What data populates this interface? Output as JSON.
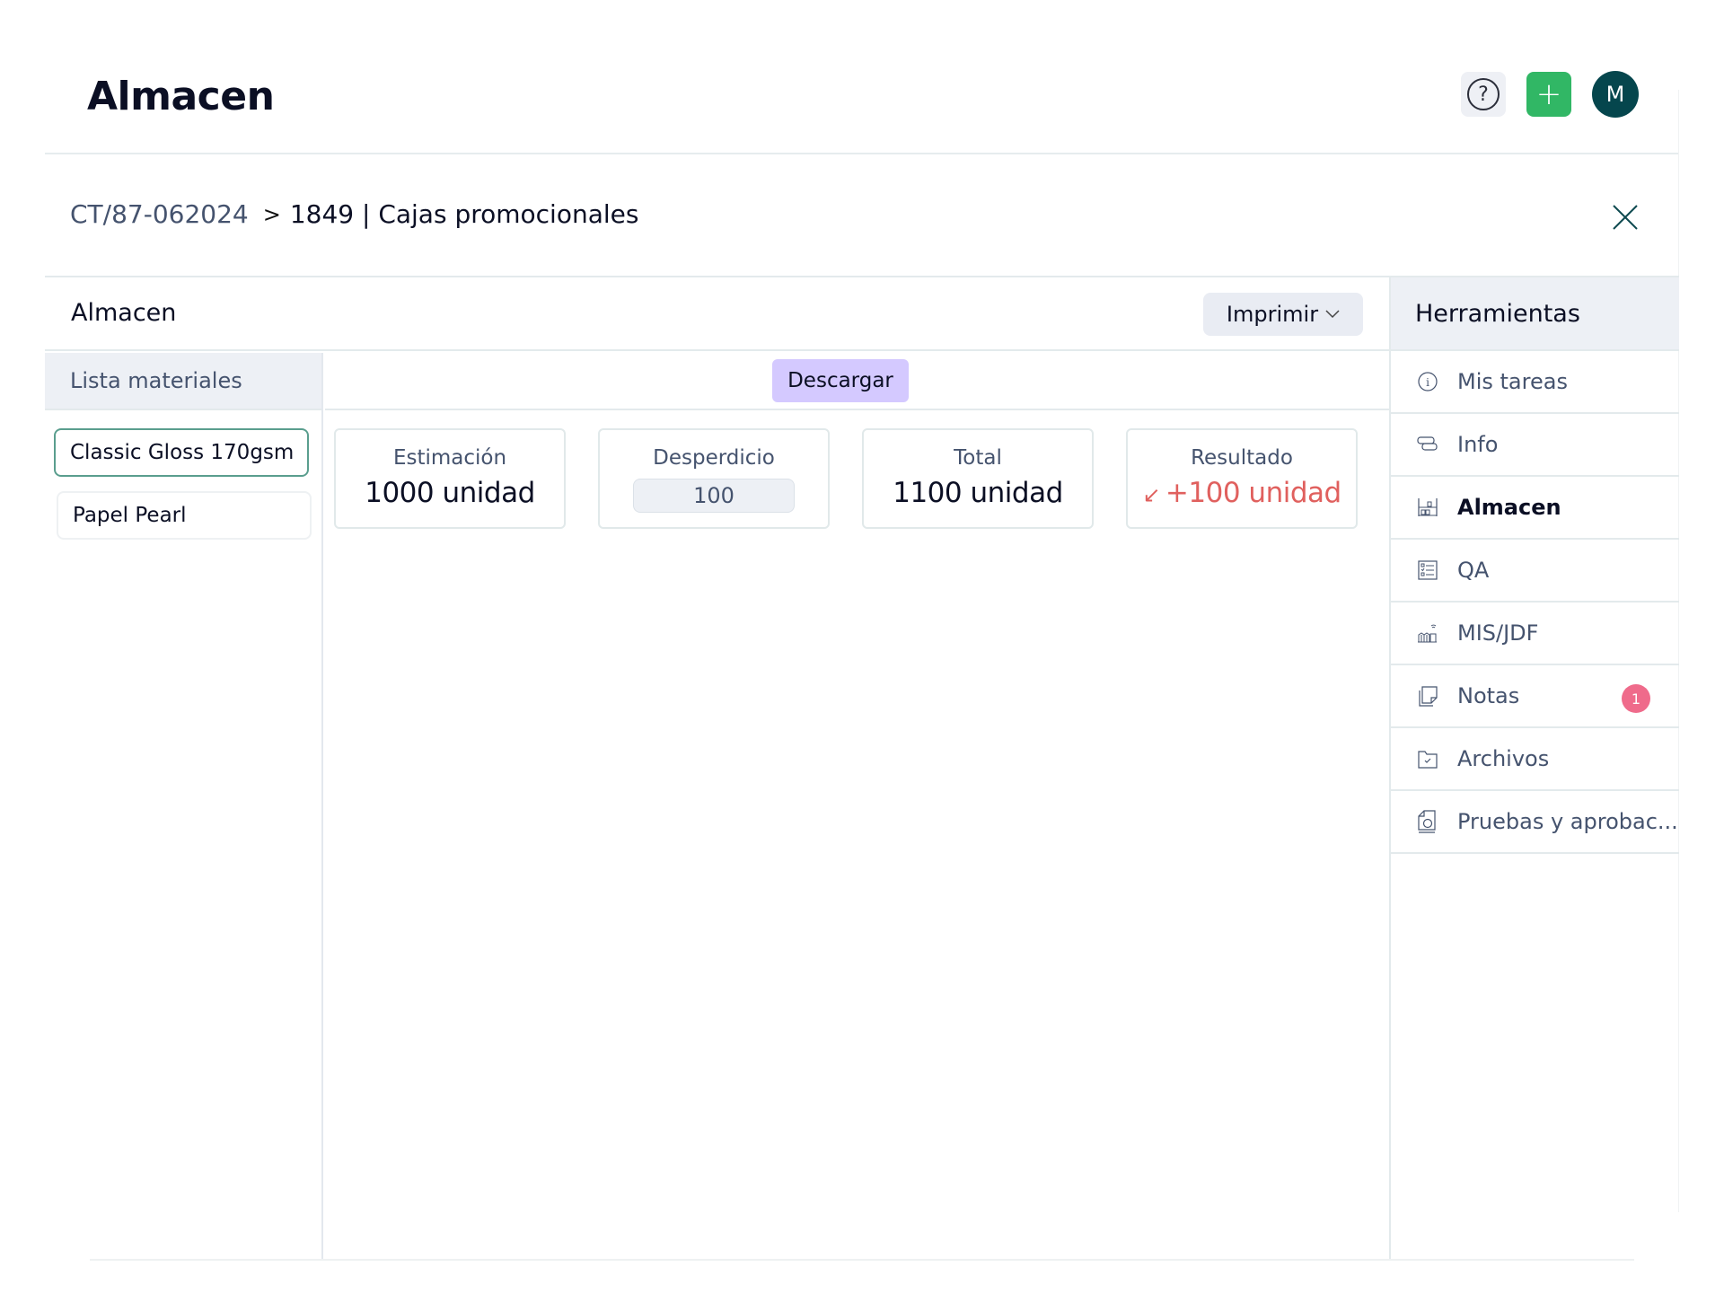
{
  "header": {
    "title": "Almacen",
    "help_icon": "question-circle-icon",
    "add_icon": "plus-icon",
    "avatar_initial": "M",
    "colors": {
      "add": "#31b765",
      "avatar": "#05464d"
    }
  },
  "breadcrumb": {
    "parent": "CT/87-062024",
    "separator": ">",
    "current": "1849 | Cajas promocionales",
    "close_icon": "close-icon"
  },
  "main": {
    "title": "Almacen",
    "print_label": "Imprimir",
    "download_label": "Descargar",
    "materials_header": "Lista materiales",
    "materials": [
      {
        "name": "Classic Gloss 170gsm",
        "selected": true
      },
      {
        "name": "Papel Pearl",
        "selected": false
      }
    ],
    "cards": {
      "estimate": {
        "label": "Estimación",
        "value": "1000 unidad"
      },
      "waste": {
        "label": "Desperdicio",
        "value": "100"
      },
      "total": {
        "label": "Total",
        "value": "1100 unidad"
      },
      "result": {
        "label": "Resultado",
        "arrow": "↙",
        "value": "+100 unidad",
        "color": "#e0605e"
      }
    }
  },
  "sidebar": {
    "title": "Herramientas",
    "items": [
      {
        "label": "Mis tareas",
        "icon": "info-circle-icon"
      },
      {
        "label": "Info",
        "icon": "layers-icon"
      },
      {
        "label": "Almacen",
        "icon": "warehouse-icon",
        "active": true
      },
      {
        "label": "QA",
        "icon": "checklist-icon"
      },
      {
        "label": "MIS/JDF",
        "icon": "factory-icon"
      },
      {
        "label": "Notas",
        "icon": "notes-icon",
        "badge": "1"
      },
      {
        "label": "Archivos",
        "icon": "folder-check-icon"
      },
      {
        "label": "Pruebas y aprobac...",
        "icon": "proof-document-icon"
      }
    ]
  }
}
